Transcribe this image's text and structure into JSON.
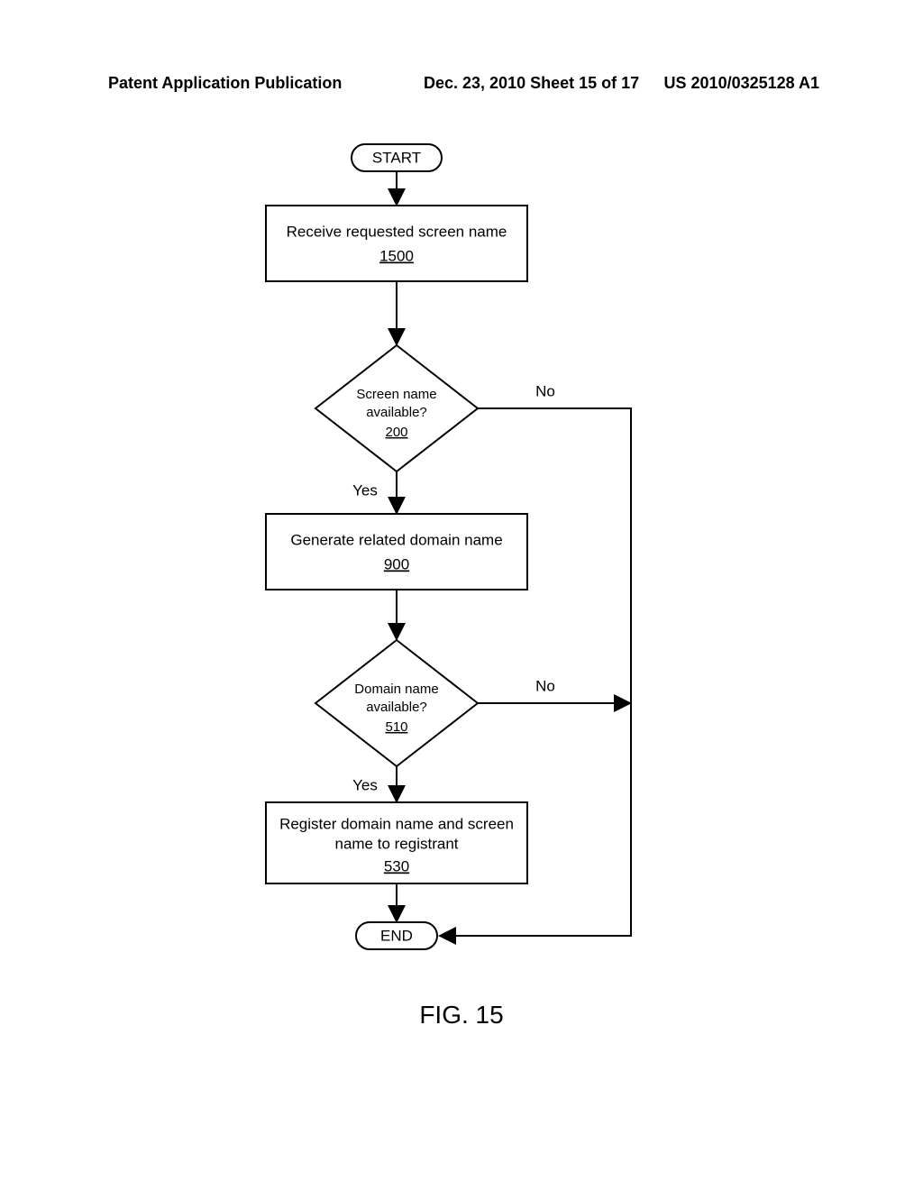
{
  "header": {
    "left": "Patent Application Publication",
    "center": "Dec. 23, 2010  Sheet 15 of 17",
    "right": "US 2010/0325128 A1"
  },
  "flow": {
    "start": "START",
    "box1": {
      "text": "Receive requested screen name",
      "num": "1500"
    },
    "dec1": {
      "l1": "Screen name",
      "l2": "available?",
      "num": "200",
      "yes": "Yes",
      "no": "No"
    },
    "box2": {
      "text": "Generate related domain name",
      "num": "900"
    },
    "dec2": {
      "l1": "Domain name",
      "l2": "available?",
      "num": "510",
      "yes": "Yes",
      "no": "No"
    },
    "box3": {
      "l1": "Register domain name and screen",
      "l2": "name to registrant",
      "num": "530"
    },
    "end": "END"
  },
  "figure_label": "FIG. 15"
}
